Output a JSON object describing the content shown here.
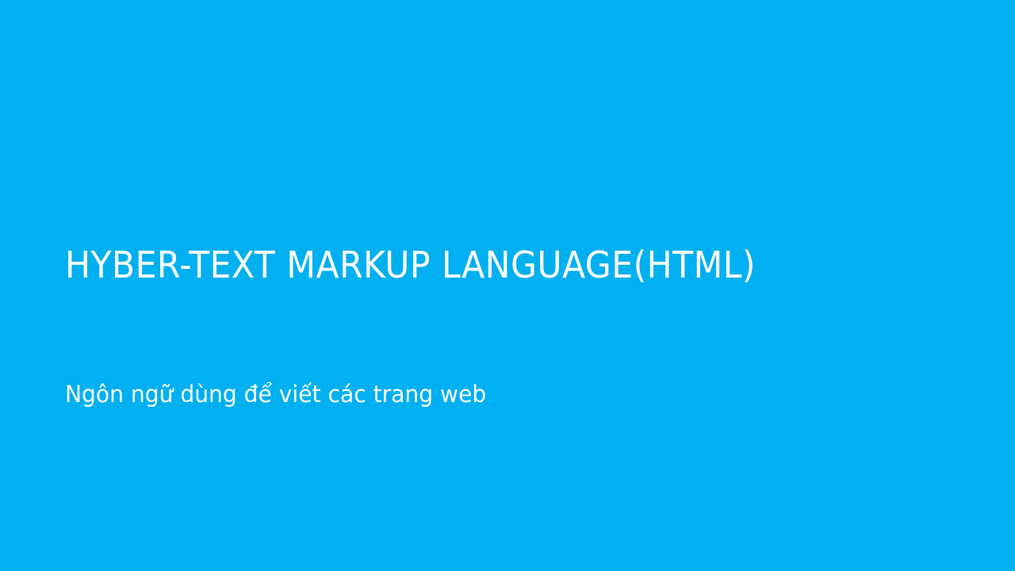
{
  "slide": {
    "title": "HYBER-TEXT MARKUP LANGUAGE(HTML)",
    "subtitle": "Ngôn ngữ dùng để viết các trang web",
    "background_color": "#00b0f0",
    "text_color": "#ffffff"
  }
}
